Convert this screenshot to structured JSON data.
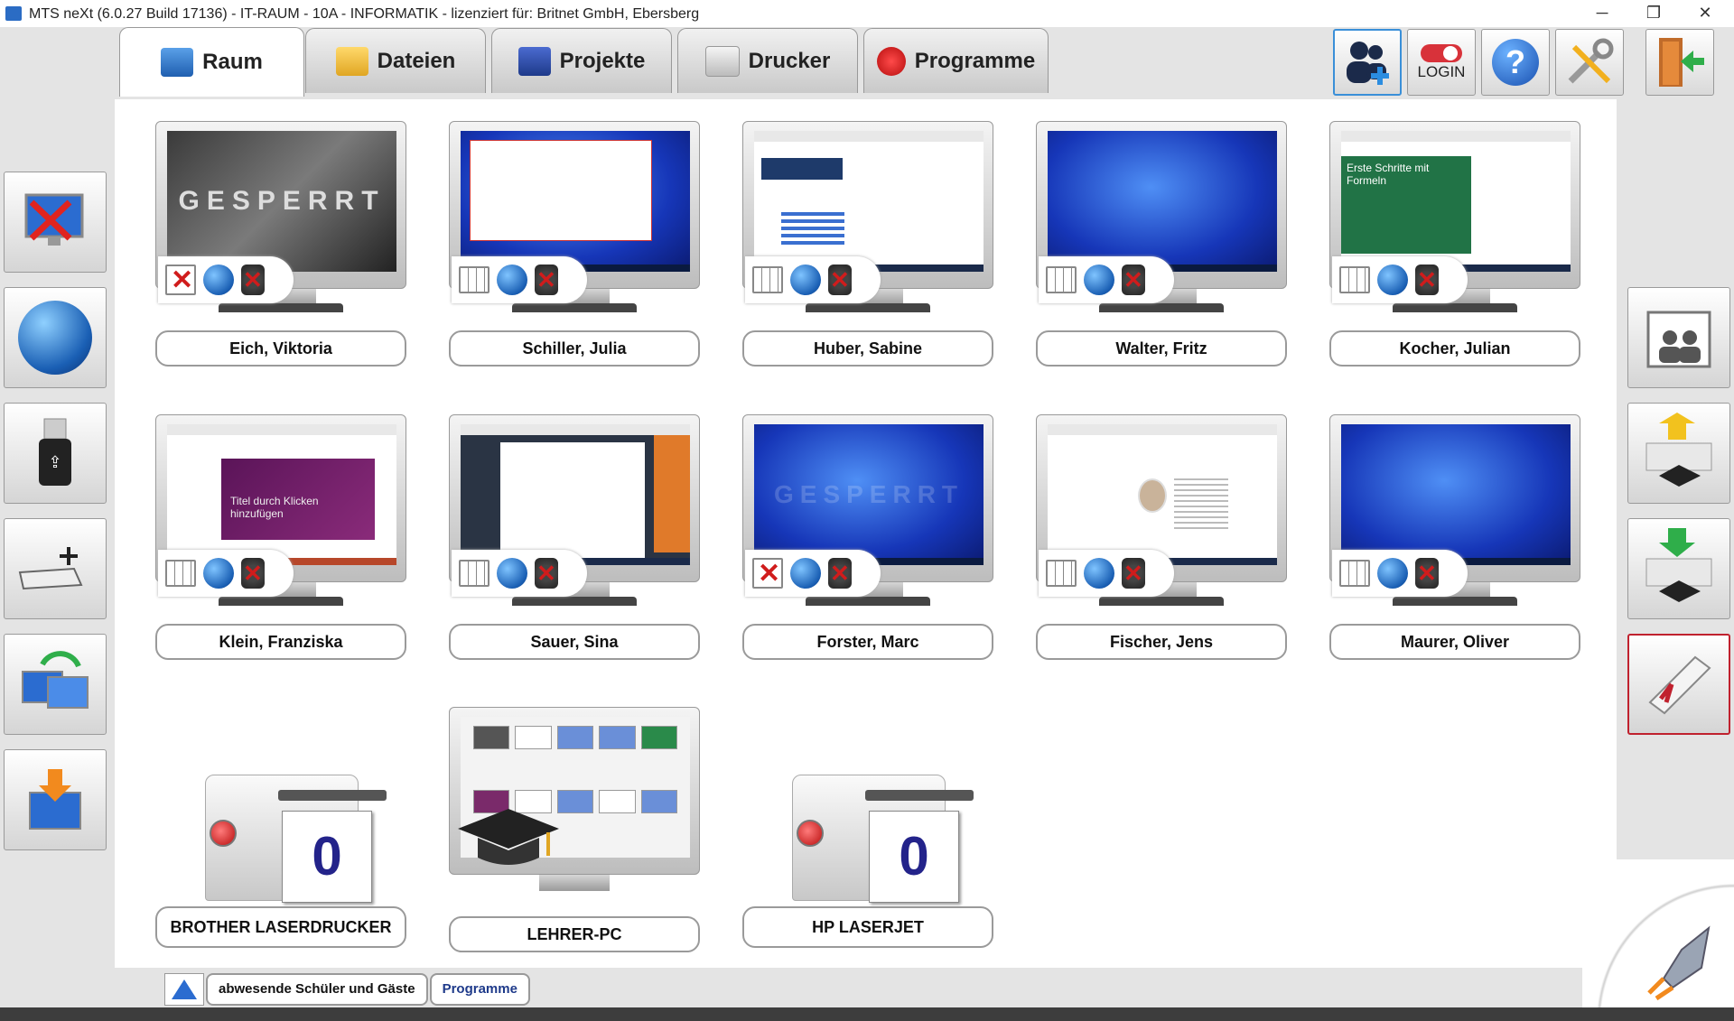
{
  "titlebar": {
    "title": "MTS neXt (6.0.27 Build 17136) - IT-RAUM - 10A - INFORMATIK - lizenziert für: Britnet GmbH, Ebersberg",
    "minimize": "─",
    "restore": "❐",
    "close": "✕"
  },
  "tabs": [
    {
      "label": "Raum",
      "active": true,
      "icon": "room-icon"
    },
    {
      "label": "Dateien",
      "icon": "folder-icon"
    },
    {
      "label": "Projekte",
      "icon": "project-icon"
    },
    {
      "label": "Drucker",
      "icon": "printer-icon"
    },
    {
      "label": "Programme",
      "icon": "stop-programs-icon"
    }
  ],
  "toolbar": {
    "add_users_icon": "add-users-icon",
    "login_label": "LOGIN",
    "help_label": "?",
    "settings_icon": "tools-icon",
    "exit_icon": "exit-icon"
  },
  "left_actions": [
    "screen-off-icon",
    "web-icon",
    "usb-icon",
    "keyboard-mouse-lock-icon",
    "restore-icon",
    "distribute-icon"
  ],
  "right_actions": [
    "group-icon",
    "collect-icon",
    "distribute-icon",
    "certificate-icon"
  ],
  "students": [
    {
      "name": "Eich, Viktoria",
      "screen": "locked",
      "screen_text": "GESPERRT",
      "blocked": true
    },
    {
      "name": "Schiller, Julia",
      "screen": "window"
    },
    {
      "name": "Huber, Sabine",
      "screen": "window"
    },
    {
      "name": "Walter, Fritz",
      "screen": "desktop"
    },
    {
      "name": "Kocher, Julian",
      "screen": "excel",
      "screen_text": "Erste Schritte mit Formeln"
    },
    {
      "name": "Klein, Franziska",
      "screen": "ppt",
      "screen_text": "Titel durch Klicken hinzufügen"
    },
    {
      "name": "Sauer, Sina",
      "screen": "window"
    },
    {
      "name": "Forster, Marc",
      "screen": "desktop-locked",
      "screen_text": "GESPERRT",
      "blocked": true
    },
    {
      "name": "Fischer, Jens",
      "screen": "window"
    },
    {
      "name": "Maurer, Oliver",
      "screen": "desktop"
    }
  ],
  "printers": [
    {
      "name": "BROTHER LASERDRUCKER",
      "count": "0"
    },
    {
      "name": "HP LASERJET",
      "count": "0"
    }
  ],
  "teacher": {
    "name": "LEHRER-PC"
  },
  "bottom": {
    "absent_label": "abwesende Schüler und Gäste",
    "programs_label": "Programme"
  },
  "colors": {
    "accent": "#3a8fd8",
    "alert": "#c0212e",
    "counter": "#23238a"
  }
}
